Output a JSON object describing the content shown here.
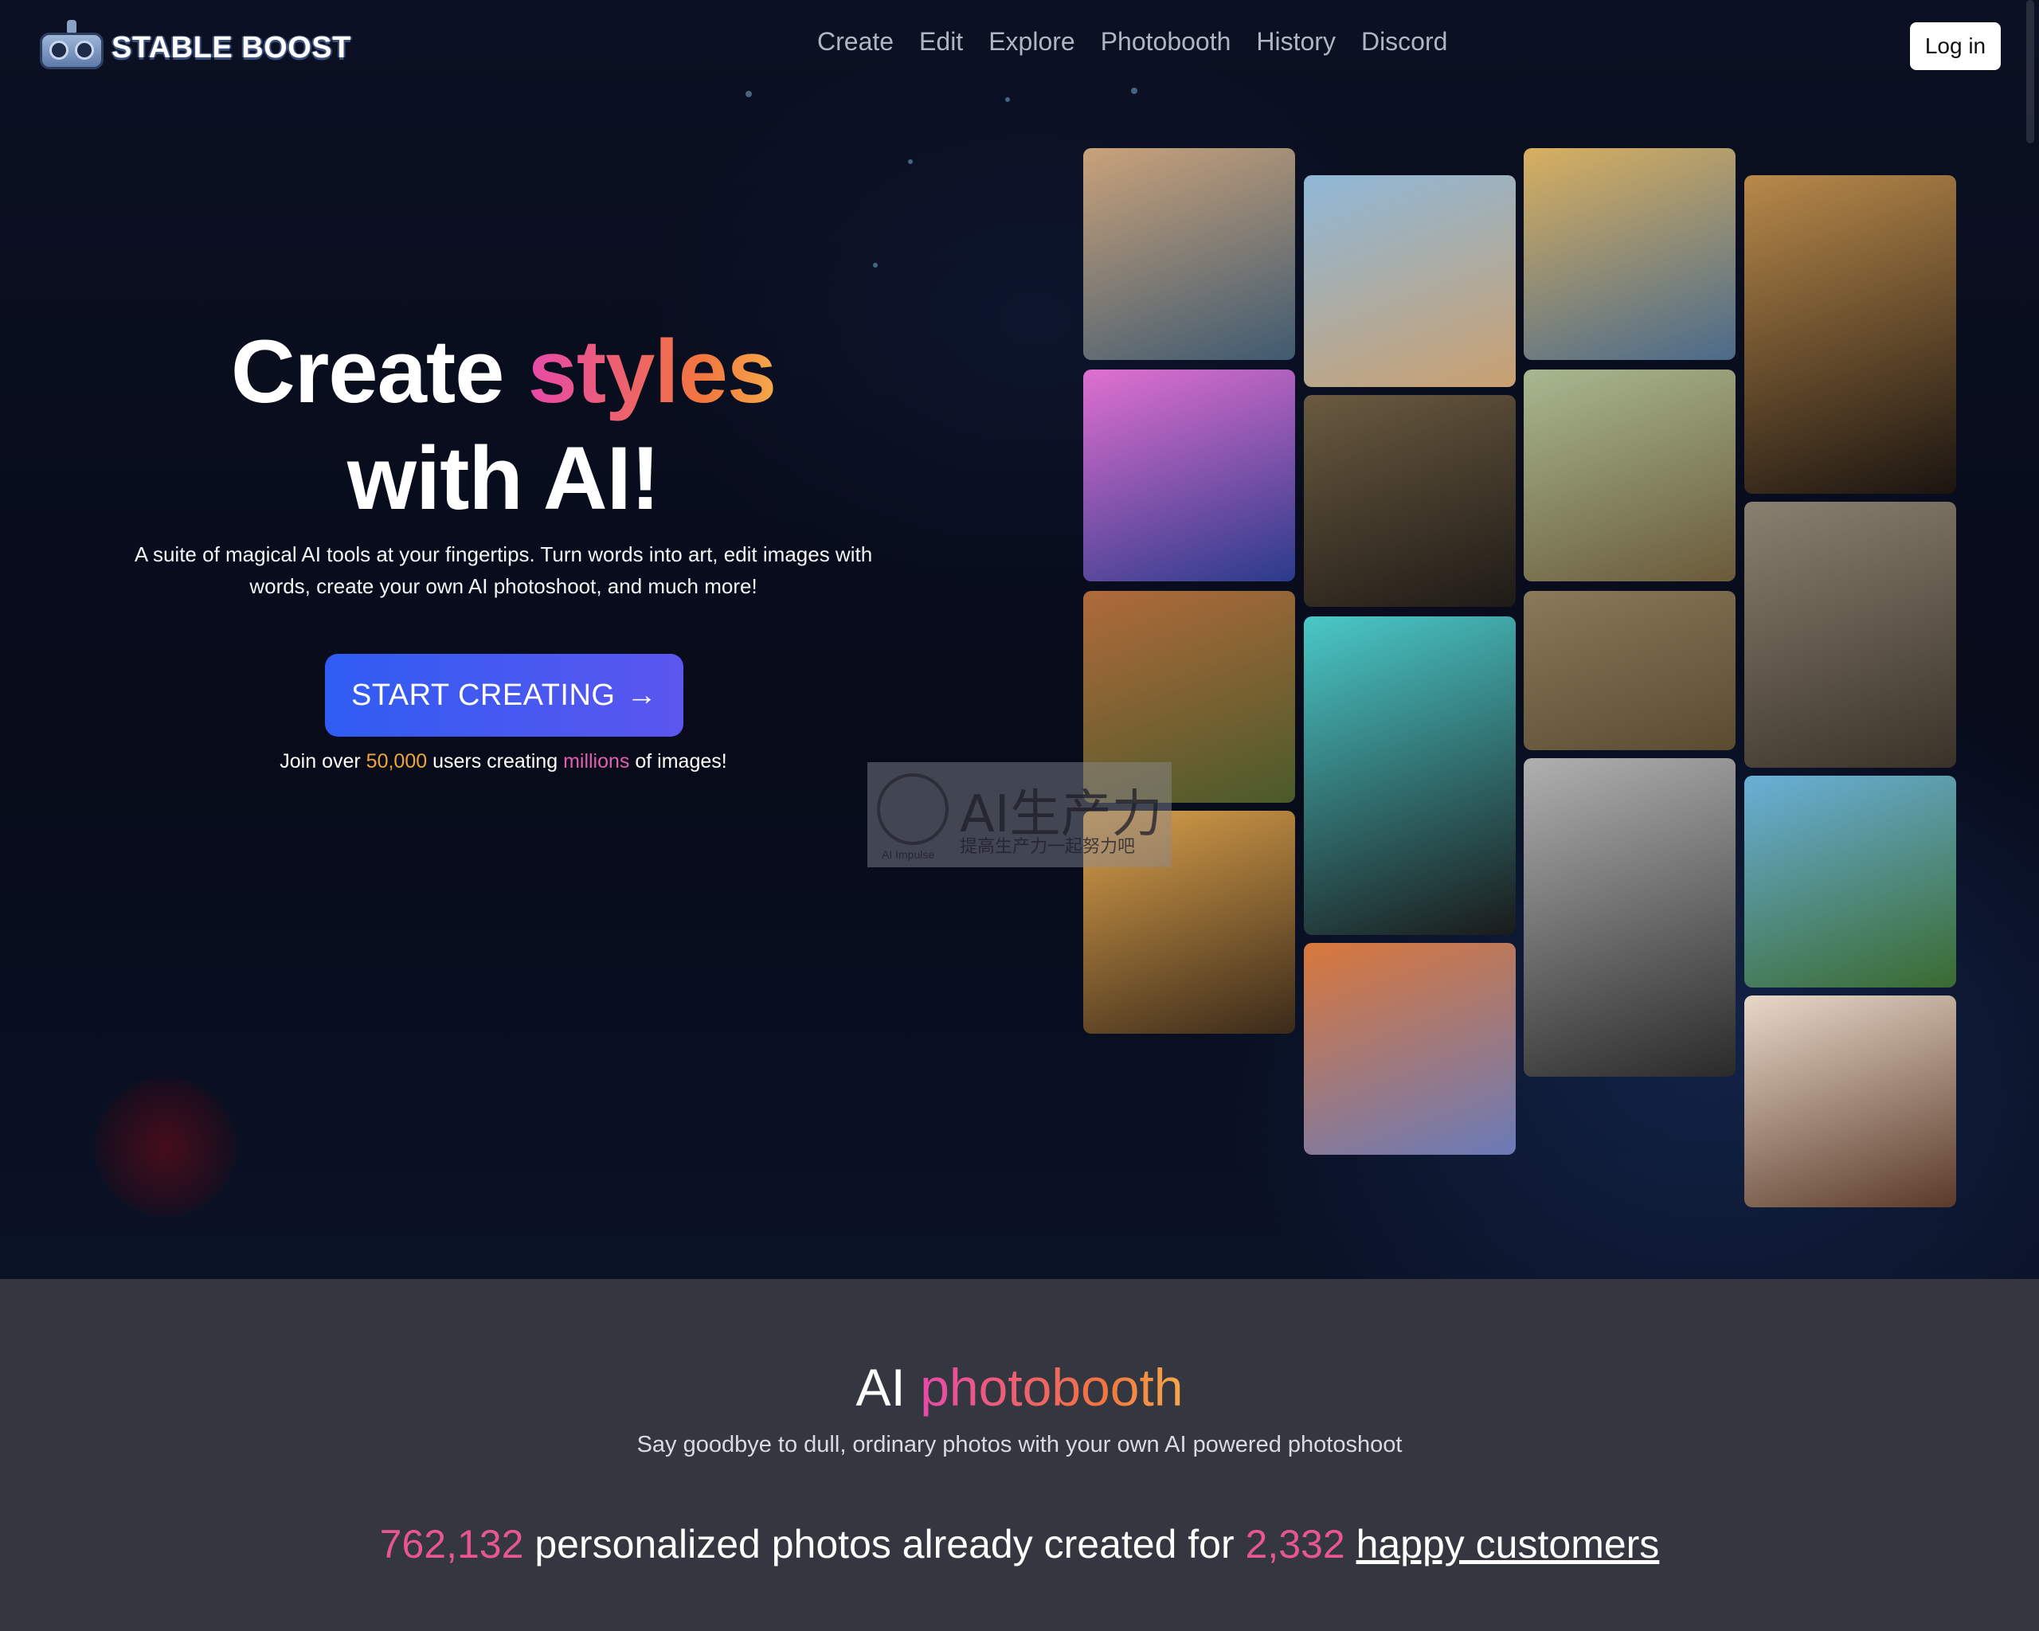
{
  "header": {
    "brand": "STABLE BOOST",
    "nav": [
      "Create",
      "Edit",
      "Explore",
      "Photobooth",
      "History",
      "Discord"
    ],
    "login_label": "Log in"
  },
  "hero": {
    "headline_prefix": "Create ",
    "headline_highlight": "styles",
    "headline_line2": "with AI!",
    "subcopy": "A suite of magical AI tools at your fingertips. Turn words into art, edit images with words, create your own AI photoshoot, and much more!",
    "cta_label": "START CREATING",
    "cta_arrow": "→",
    "join_prefix": "Join over ",
    "join_users": "50,000",
    "join_mid": " users creating ",
    "join_millions": "millions",
    "join_suffix": " of images!"
  },
  "watermark": {
    "title": "AI生产力",
    "subtitle": "提高生产力一起努力吧",
    "logo_text": "AI Impulse"
  },
  "gallery": [
    {
      "name": "street-cars-painting",
      "colors": [
        "#c9a27a",
        "#3f5a70"
      ]
    },
    {
      "name": "black-dog-colorful",
      "colors": [
        "#e070d0",
        "#2a3a8a"
      ]
    },
    {
      "name": "redhead-woman-portrait",
      "colors": [
        "#b06a3a",
        "#4a5a2a"
      ]
    },
    {
      "name": "african-woman-crown",
      "colors": [
        "#d9a04a",
        "#3a2a1a"
      ]
    },
    {
      "name": "cartoon-boy-robot",
      "colors": [
        "#8fb8d8",
        "#c9a070"
      ]
    },
    {
      "name": "dark-castle",
      "colors": [
        "#6a5a40",
        "#1e1a16"
      ]
    },
    {
      "name": "anime-teal-girl",
      "colors": [
        "#4ac8c8",
        "#1a1a1a"
      ]
    },
    {
      "name": "fox-closeup",
      "colors": [
        "#d9783a",
        "#6a7ab8"
      ]
    },
    {
      "name": "winged-dog",
      "colors": [
        "#d8b060",
        "#4a6a8a"
      ]
    },
    {
      "name": "forest-road",
      "colors": [
        "#a8b890",
        "#6a5a3a"
      ]
    },
    {
      "name": "green-sports-car",
      "colors": [
        "#8a7a5a",
        "#5a4a30"
      ]
    },
    {
      "name": "armored-lion-warrior",
      "colors": [
        "#b0b0b0",
        "#2a2a2a"
      ]
    },
    {
      "name": "man-in-gold-suit",
      "colors": [
        "#b8894a",
        "#1a1410"
      ]
    },
    {
      "name": "domed-building-ruins",
      "colors": [
        "#8a8070",
        "#3a3228"
      ]
    },
    {
      "name": "mountain-lake-landscape",
      "colors": [
        "#6ab0d8",
        "#3a6a30"
      ]
    },
    {
      "name": "smiling-woman-3d",
      "colors": [
        "#e8d8c8",
        "#5a3a2a"
      ]
    }
  ],
  "photobooth": {
    "title_prefix": "AI ",
    "title_highlight": "photobooth",
    "subtitle": "Say goodbye to dull, ordinary photos with your own AI powered photoshoot",
    "photos_count": "762,132",
    "photos_mid": " personalized photos already created for ",
    "customers_count": "2,332",
    "customers_link": "happy customers"
  }
}
